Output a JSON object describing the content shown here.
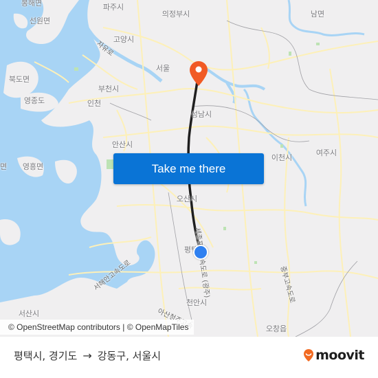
{
  "map": {
    "places": [
      {
        "name": "봉해면",
        "id": "bonghae"
      },
      {
        "name": "파주시",
        "id": "paju"
      },
      {
        "name": "의정부시",
        "id": "uijeongbu"
      },
      {
        "name": "남면",
        "id": "nammyeon"
      },
      {
        "name": "선원면",
        "id": "seonwon"
      },
      {
        "name": "고양시",
        "id": "goyang"
      },
      {
        "name": "서울",
        "id": "seoul"
      },
      {
        "name": "북도면",
        "id": "bukdo"
      },
      {
        "name": "부천시",
        "id": "bucheon"
      },
      {
        "name": "영종도",
        "id": "yeongjong"
      },
      {
        "name": "인천",
        "id": "incheon"
      },
      {
        "name": "성남시",
        "id": "seongnam"
      },
      {
        "name": "안산시",
        "id": "ansan"
      },
      {
        "name": "이천시",
        "id": "icheon"
      },
      {
        "name": "여주시",
        "id": "yeoju"
      },
      {
        "name": "영흥면",
        "id": "yeongheung"
      },
      {
        "name": "면",
        "id": "edge-myeon"
      },
      {
        "name": "오산시",
        "id": "osan"
      },
      {
        "name": "평택",
        "id": "pyeongtaek"
      },
      {
        "name": "천안시",
        "id": "cheonan"
      },
      {
        "name": "서산시",
        "id": "seosan"
      },
      {
        "name": "오창읍",
        "id": "ochang"
      }
    ],
    "roads": [
      {
        "name": "자유로",
        "id": "jayuro"
      },
      {
        "name": "세종포천고속도로 (광주)",
        "id": "sejong-pocheon"
      },
      {
        "name": "서해안고속도로",
        "id": "seohaean"
      },
      {
        "name": "중부고속도로",
        "id": "jungbu"
      },
      {
        "name": "아산청주고속",
        "id": "asan-cheongju"
      }
    ],
    "attribution": "© OpenStreetMap contributors | © OpenMapTiles",
    "colors": {
      "water": "#a8d4f5",
      "land": "#f0eff0",
      "road": "#fdf0b8",
      "route": "#1f1f1f",
      "destination": "#f15a24",
      "origin": "#2f80f0"
    }
  },
  "cta": {
    "label": "Take me there",
    "color": "#0a74d6"
  },
  "footer": {
    "origin": "평택시, 경기도",
    "arrow": "→",
    "destination": "강동구, 서울시",
    "brand": "moovit",
    "brand_color": "#f26a21"
  }
}
